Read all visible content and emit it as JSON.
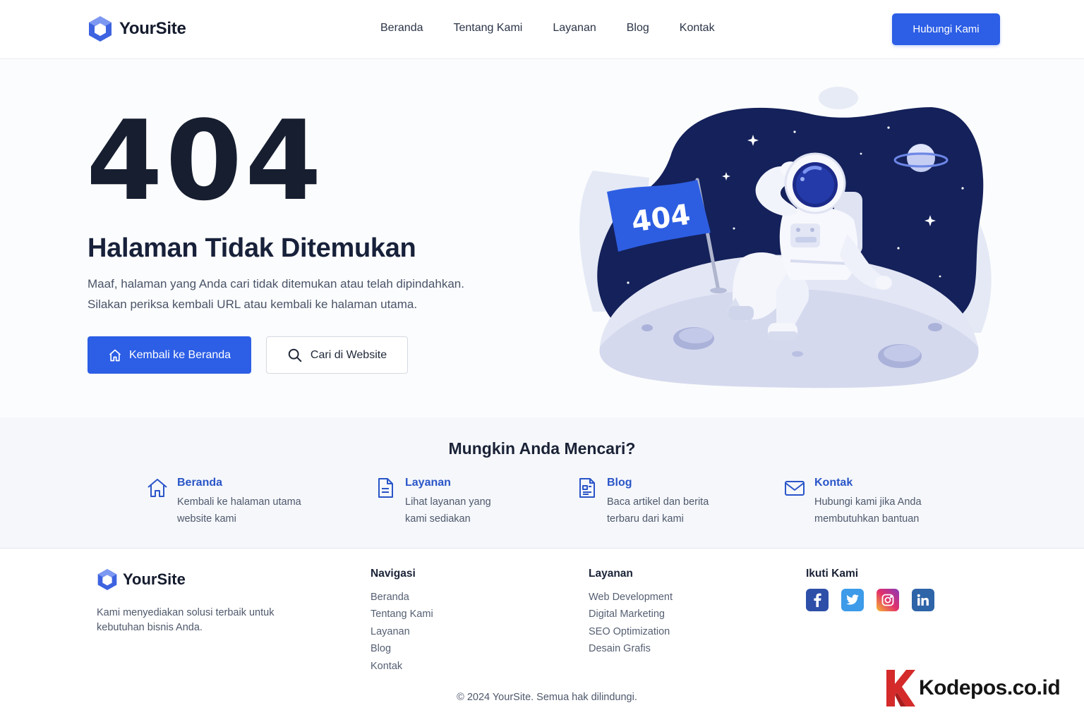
{
  "header": {
    "logo_text": "YourSite",
    "nav": [
      "Beranda",
      "Tentang Kami",
      "Layanan",
      "Blog",
      "Kontak"
    ],
    "cta_label": "Hubungi Kami"
  },
  "hero": {
    "code": "404",
    "title": "Halaman Tidak Ditemukan",
    "desc_line1": "Maaf, halaman yang Anda cari tidak ditemukan atau telah dipindahkan.",
    "desc_line2": "Silakan periksa kembali URL atau kembali ke halaman utama.",
    "btn_home": "Kembali ke Beranda",
    "btn_search": "Cari di Website",
    "flag_text": "404"
  },
  "suggest": {
    "title": "Mungkin Anda Mencari?",
    "items": [
      {
        "title": "Beranda",
        "line1": "Kembali ke halaman utama",
        "line2": "website kami",
        "icon": "home-icon"
      },
      {
        "title": "Layanan",
        "line1": "Lihat layanan yang",
        "line2": "kami sediakan",
        "icon": "document-icon"
      },
      {
        "title": "Blog",
        "line1": "Baca artikel dan berita",
        "line2": "terbaru dari kami",
        "icon": "article-icon"
      },
      {
        "title": "Kontak",
        "line1": "Hubungi kami jika Anda",
        "line2": "membutuhkan bantuan",
        "icon": "mail-icon"
      }
    ]
  },
  "footer": {
    "logo_text": "YourSite",
    "desc": "Kami menyediakan solusi terbaik untuk kebutuhan bisnis Anda.",
    "nav_title": "Navigasi",
    "nav_links": [
      "Beranda",
      "Tentang Kami",
      "Layanan",
      "Blog",
      "Kontak"
    ],
    "services_title": "Layanan",
    "services_links": [
      "Web Development",
      "Digital Marketing",
      "SEO Optimization",
      "Desain Grafis"
    ],
    "follow_title": "Ikuti Kami",
    "socials": [
      "facebook-icon",
      "twitter-icon",
      "instagram-icon",
      "linkedin-icon"
    ],
    "copyright": "© 2024 YourSite. Semua hak dilindungi."
  },
  "watermark": "Kodepos.co.id",
  "colors": {
    "primary": "#2c5ee6",
    "dark": "#161e30",
    "navy": "#14215a",
    "accent_link": "#2a55c8"
  }
}
